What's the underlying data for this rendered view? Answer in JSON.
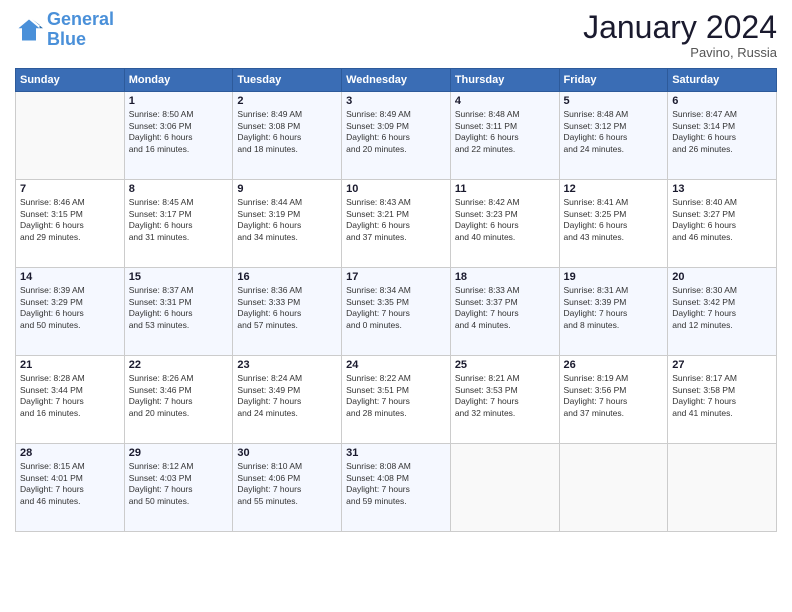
{
  "header": {
    "logo_general": "General",
    "logo_blue": "Blue",
    "month_title": "January 2024",
    "location": "Pavino, Russia"
  },
  "days_of_week": [
    "Sunday",
    "Monday",
    "Tuesday",
    "Wednesday",
    "Thursday",
    "Friday",
    "Saturday"
  ],
  "weeks": [
    [
      {
        "day": "",
        "info": ""
      },
      {
        "day": "1",
        "info": "Sunrise: 8:50 AM\nSunset: 3:06 PM\nDaylight: 6 hours\nand 16 minutes."
      },
      {
        "day": "2",
        "info": "Sunrise: 8:49 AM\nSunset: 3:08 PM\nDaylight: 6 hours\nand 18 minutes."
      },
      {
        "day": "3",
        "info": "Sunrise: 8:49 AM\nSunset: 3:09 PM\nDaylight: 6 hours\nand 20 minutes."
      },
      {
        "day": "4",
        "info": "Sunrise: 8:48 AM\nSunset: 3:11 PM\nDaylight: 6 hours\nand 22 minutes."
      },
      {
        "day": "5",
        "info": "Sunrise: 8:48 AM\nSunset: 3:12 PM\nDaylight: 6 hours\nand 24 minutes."
      },
      {
        "day": "6",
        "info": "Sunrise: 8:47 AM\nSunset: 3:14 PM\nDaylight: 6 hours\nand 26 minutes."
      }
    ],
    [
      {
        "day": "7",
        "info": "Sunrise: 8:46 AM\nSunset: 3:15 PM\nDaylight: 6 hours\nand 29 minutes."
      },
      {
        "day": "8",
        "info": "Sunrise: 8:45 AM\nSunset: 3:17 PM\nDaylight: 6 hours\nand 31 minutes."
      },
      {
        "day": "9",
        "info": "Sunrise: 8:44 AM\nSunset: 3:19 PM\nDaylight: 6 hours\nand 34 minutes."
      },
      {
        "day": "10",
        "info": "Sunrise: 8:43 AM\nSunset: 3:21 PM\nDaylight: 6 hours\nand 37 minutes."
      },
      {
        "day": "11",
        "info": "Sunrise: 8:42 AM\nSunset: 3:23 PM\nDaylight: 6 hours\nand 40 minutes."
      },
      {
        "day": "12",
        "info": "Sunrise: 8:41 AM\nSunset: 3:25 PM\nDaylight: 6 hours\nand 43 minutes."
      },
      {
        "day": "13",
        "info": "Sunrise: 8:40 AM\nSunset: 3:27 PM\nDaylight: 6 hours\nand 46 minutes."
      }
    ],
    [
      {
        "day": "14",
        "info": "Sunrise: 8:39 AM\nSunset: 3:29 PM\nDaylight: 6 hours\nand 50 minutes."
      },
      {
        "day": "15",
        "info": "Sunrise: 8:37 AM\nSunset: 3:31 PM\nDaylight: 6 hours\nand 53 minutes."
      },
      {
        "day": "16",
        "info": "Sunrise: 8:36 AM\nSunset: 3:33 PM\nDaylight: 6 hours\nand 57 minutes."
      },
      {
        "day": "17",
        "info": "Sunrise: 8:34 AM\nSunset: 3:35 PM\nDaylight: 7 hours\nand 0 minutes."
      },
      {
        "day": "18",
        "info": "Sunrise: 8:33 AM\nSunset: 3:37 PM\nDaylight: 7 hours\nand 4 minutes."
      },
      {
        "day": "19",
        "info": "Sunrise: 8:31 AM\nSunset: 3:39 PM\nDaylight: 7 hours\nand 8 minutes."
      },
      {
        "day": "20",
        "info": "Sunrise: 8:30 AM\nSunset: 3:42 PM\nDaylight: 7 hours\nand 12 minutes."
      }
    ],
    [
      {
        "day": "21",
        "info": "Sunrise: 8:28 AM\nSunset: 3:44 PM\nDaylight: 7 hours\nand 16 minutes."
      },
      {
        "day": "22",
        "info": "Sunrise: 8:26 AM\nSunset: 3:46 PM\nDaylight: 7 hours\nand 20 minutes."
      },
      {
        "day": "23",
        "info": "Sunrise: 8:24 AM\nSunset: 3:49 PM\nDaylight: 7 hours\nand 24 minutes."
      },
      {
        "day": "24",
        "info": "Sunrise: 8:22 AM\nSunset: 3:51 PM\nDaylight: 7 hours\nand 28 minutes."
      },
      {
        "day": "25",
        "info": "Sunrise: 8:21 AM\nSunset: 3:53 PM\nDaylight: 7 hours\nand 32 minutes."
      },
      {
        "day": "26",
        "info": "Sunrise: 8:19 AM\nSunset: 3:56 PM\nDaylight: 7 hours\nand 37 minutes."
      },
      {
        "day": "27",
        "info": "Sunrise: 8:17 AM\nSunset: 3:58 PM\nDaylight: 7 hours\nand 41 minutes."
      }
    ],
    [
      {
        "day": "28",
        "info": "Sunrise: 8:15 AM\nSunset: 4:01 PM\nDaylight: 7 hours\nand 46 minutes."
      },
      {
        "day": "29",
        "info": "Sunrise: 8:12 AM\nSunset: 4:03 PM\nDaylight: 7 hours\nand 50 minutes."
      },
      {
        "day": "30",
        "info": "Sunrise: 8:10 AM\nSunset: 4:06 PM\nDaylight: 7 hours\nand 55 minutes."
      },
      {
        "day": "31",
        "info": "Sunrise: 8:08 AM\nSunset: 4:08 PM\nDaylight: 7 hours\nand 59 minutes."
      },
      {
        "day": "",
        "info": ""
      },
      {
        "day": "",
        "info": ""
      },
      {
        "day": "",
        "info": ""
      }
    ]
  ]
}
